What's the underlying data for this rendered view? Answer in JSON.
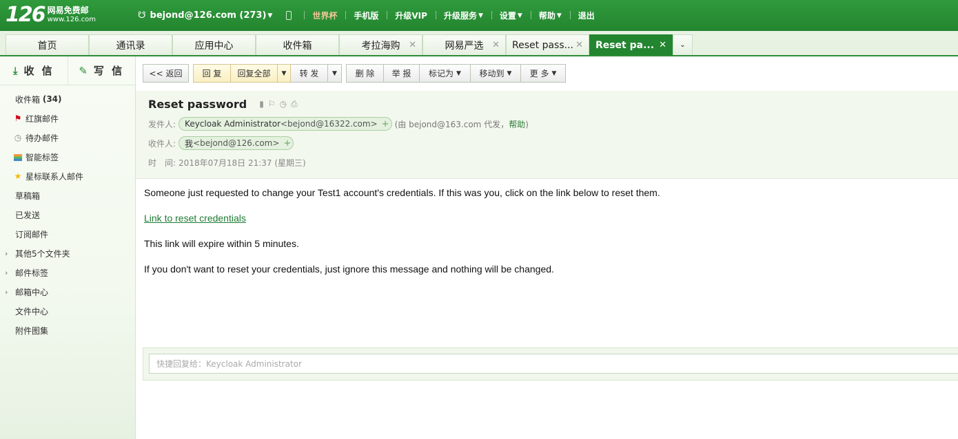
{
  "header": {
    "logo_num": "126",
    "logo_line1": "网易免费邮",
    "logo_line2": "www.126.com",
    "account": "bejond@126.com (273)",
    "nav": [
      "世界杯",
      "手机版",
      "升级VIP",
      "升级服务",
      "设置",
      "帮助",
      "退出"
    ]
  },
  "tabs": [
    {
      "label": "首页"
    },
    {
      "label": "通讯录"
    },
    {
      "label": "应用中心"
    },
    {
      "label": "收件箱"
    },
    {
      "label": "考拉海购"
    },
    {
      "label": "网易严选"
    },
    {
      "label": "Reset pass..."
    },
    {
      "label": "Reset pa..."
    }
  ],
  "sidebar": {
    "receive": "收 信",
    "compose": "写 信",
    "folders": [
      {
        "label": "收件箱",
        "count": "(34)"
      },
      {
        "label": "红旗邮件"
      },
      {
        "label": "待办邮件"
      },
      {
        "label": "智能标签"
      },
      {
        "label": "星标联系人邮件"
      },
      {
        "label": "草稿箱"
      },
      {
        "label": "已发送"
      },
      {
        "label": "订阅邮件"
      },
      {
        "label": "其他5个文件夹"
      },
      {
        "label": "邮件标签"
      },
      {
        "label": "邮箱中心"
      },
      {
        "label": "文件中心"
      },
      {
        "label": "附件图集"
      }
    ]
  },
  "toolbar": {
    "back": "<< 返回",
    "reply": "回 复",
    "reply_all": "回复全部",
    "forward": "转 发",
    "delete": "删 除",
    "report": "举 报",
    "mark_as": "标记为",
    "move_to": "移动到",
    "more": "更 多"
  },
  "mail": {
    "subject": "Reset password",
    "from_label": "发件人:",
    "from_name": "Keycloak Administrator",
    "from_addr": "<bejond@16322.com>",
    "via_text": "(由 bejond@163.com 代发，",
    "via_help": "帮助",
    "via_close": ")",
    "to_label": "收件人:",
    "to_name": "我",
    "to_addr": "<bejond@126.com>",
    "time_label": "时　间:",
    "time_value": "2018年07月18日 21:37 (星期三)",
    "body": {
      "p1": "Someone just requested to change your Test1 account's credentials. If this was you, click on the link below to reset them.",
      "link": "Link to reset credentials",
      "p2": "This link will expire within 5 minutes.",
      "p3": "If you don't want to reset your credentials, just ignore this message and nothing will be changed."
    },
    "quick_reply_placeholder": "快捷回复给：Keycloak Administrator"
  }
}
